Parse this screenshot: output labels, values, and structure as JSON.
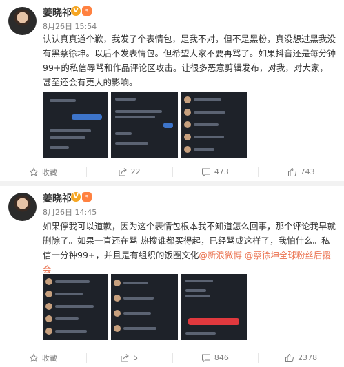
{
  "posts": [
    {
      "username": "姜晓祁",
      "level": "9",
      "time": "8月26日 15:54",
      "text": "认认真真道个歉，我发了个表情包，是我不对，但不是黑粉，真没想过黑我没有黑蔡徐坤。以后不发表情包。但希望大家不要再骂了。如果抖音还是每分钟99+的私信辱骂和作品评论区攻击。让很多恶意剪辑发布，对我，对大家，甚至还会有更大的影响。",
      "actions": {
        "favorite": "收藏",
        "share": "22",
        "comment": "473",
        "like": "743"
      }
    },
    {
      "username": "姜晓祁",
      "level": "9",
      "time": "8月26日 14:45",
      "text_plain": "如果停我可以道歉，因为这个表情包根本我不知道怎么回事，那个评论我早就删除了。如果一直还在骂 热搜谁都买得起，已经骂成这样了，我怕什么。私信一分钟99+，并且是有组织的饭圈文化",
      "mention1": "@新浪微博",
      "mention2": "@蔡徐坤全球粉丝后援会",
      "actions": {
        "favorite": "收藏",
        "share": "5",
        "comment": "846",
        "like": "2378"
      }
    }
  ]
}
